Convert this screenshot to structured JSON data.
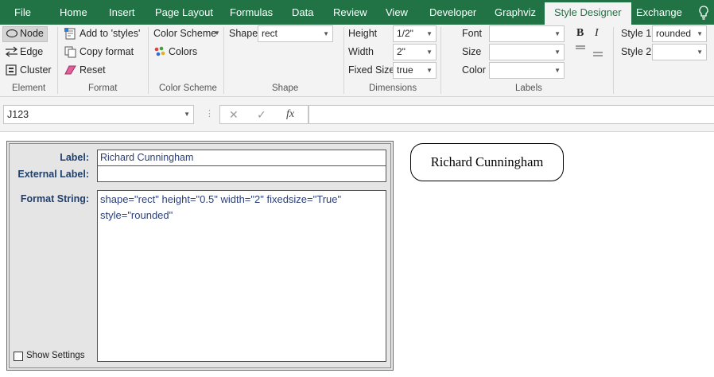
{
  "ribbon_tabs": [
    "File",
    "Home",
    "Insert",
    "Page Layout",
    "Formulas",
    "Data",
    "Review",
    "View",
    "Developer",
    "Graphviz",
    "Style Designer",
    "Exchange"
  ],
  "active_tab": "Style Designer",
  "element_group": {
    "label": "Element",
    "node": "Node",
    "edge": "Edge",
    "cluster": "Cluster"
  },
  "format_group": {
    "label": "Format",
    "add_to_styles": "Add to 'styles'",
    "copy_format": "Copy format",
    "reset": "Reset"
  },
  "color_scheme_group": {
    "label": "Color Scheme",
    "color_scheme": "Color Scheme",
    "colors": "Colors"
  },
  "shape_group": {
    "label": "Shape",
    "shape_label": "Shape",
    "shape_value": "rect"
  },
  "dimensions_group": {
    "label": "Dimensions",
    "height_label": "Height",
    "height_value": "1/2\"",
    "width_label": "Width",
    "width_value": "2\"",
    "fixed_size_label": "Fixed Size",
    "fixed_size_value": "true"
  },
  "labels_group": {
    "label": "Labels",
    "font_label": "Font",
    "size_label": "Size",
    "color_label": "Color",
    "bold": "B",
    "italic": "I",
    "style1_label": "Style 1",
    "style1_value": "rounded",
    "style2_label": "Style 2"
  },
  "formula_bar": {
    "name_box": "J123",
    "cancel": "✕",
    "enter": "✓",
    "fx": "fx"
  },
  "form": {
    "label_caption": "Label:",
    "label_value": "Richard Cunningham",
    "external_label_caption": "External Label:",
    "external_label_value": "",
    "format_string_caption": "Format String:",
    "format_string_value": "shape=\"rect\" height=\"0.5\" width=\"2\" fixedsize=\"True\" style=\"rounded\"",
    "show_settings": "Show Settings"
  },
  "graph_node": {
    "text": "Richard Cunningham"
  },
  "icons": {
    "lightbulb": "lightbulb-icon",
    "node": "node-ellipse-icon",
    "edge": "edge-arrows-icon",
    "cluster": "cluster-box-icon",
    "add": "add-style-icon",
    "copy": "copy-format-icon",
    "reset": "eraser-icon",
    "colors": "palette-icon"
  },
  "colors": {
    "accent": "#217346",
    "label_text": "#1f3f6e",
    "value_text": "#2b3f7a"
  }
}
